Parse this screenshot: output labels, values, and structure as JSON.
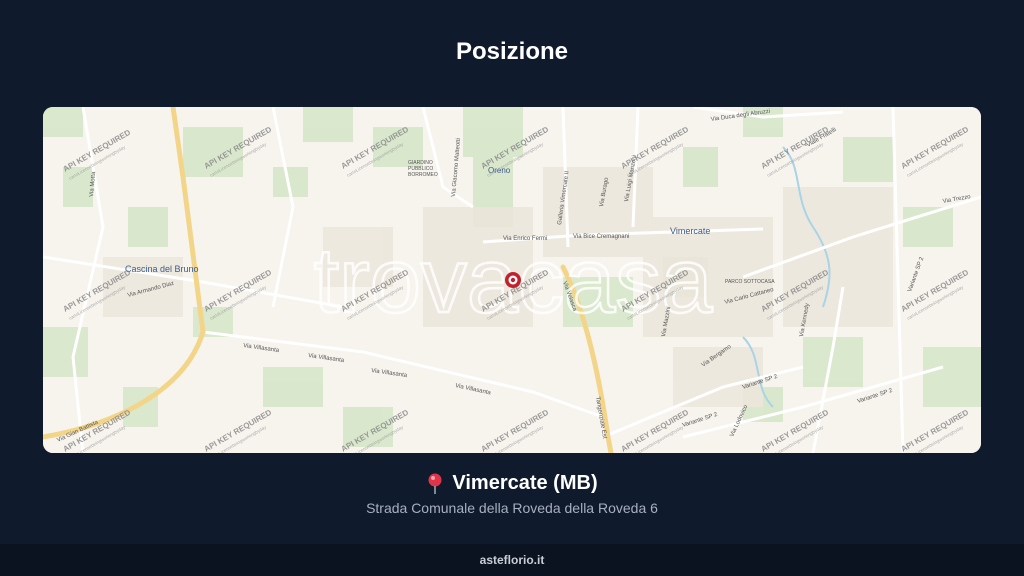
{
  "page": {
    "title": "Posizione"
  },
  "map": {
    "watermark": "trovacasa",
    "api_notice": "API KEY REQUIRED",
    "api_notice_sub": "cartoLicensebeingworkingbyday",
    "place_labels": {
      "vimercate": "Vimercate",
      "oreno": "Oreno",
      "cascina_del_bruno": "Cascina del Bruno",
      "giardino_1": "GIARDINO",
      "giardino_2": "PUBBLICO",
      "giardino_3": "BORROMEO",
      "parco": "PARCO SOTTOCASA"
    },
    "street_labels": {
      "via_villasanta_1": "Via Villasanta",
      "via_villasanta_2": "Via Villasanta",
      "via_villasanta_3": "Via Villasanta",
      "via_villasanta_4": "Via Villasanta",
      "via_enrico_fermi": "Via Enrico Fermi",
      "via_bice_cremagnani": "Via Bice Cremagnani",
      "galleria_vimercate": "Galleria Vimercate II",
      "via_giacomo_matteotti": "Via Giacomo Matteotti",
      "via_duca_abruzzi": "Via Duca degli Abruzzi",
      "via_trezzo": "Via Trezzo",
      "variante_sp2_1": "Variante SP 2",
      "variante_sp2_2": "Variante SP 2",
      "variante_sp2_3": "Variante SP 2",
      "variante_sp2_4": "Variante SP 2",
      "via_carlo_cattaneo": "Via Carlo Cattaneo",
      "via_bergamo": "Via Bergamo",
      "tangenziale_est": "Tangenziale Est",
      "via_gian_battista": "Via Gian Battista",
      "via_luigi_manzoni": "Via Luigi Manzoni",
      "via_burago": "Via Burago",
      "via_kennedy": "Via Kennedy",
      "via_armando_diaz": "Via Armando Diaz",
      "via_mazzini": "Via Mazzini",
      "via_velasca": "Via Velasca",
      "via_motta": "Via Motta",
      "via_lodovico": "Via Lodovico",
      "viale_fratelli": "Viale Fratelli"
    },
    "colors": {
      "land": "#f7f4ee",
      "green": "#cfe3c2",
      "road_major": "#f3d58a",
      "road_minor": "#ffffff",
      "water": "#a9d3e6",
      "marker": "#c0222f",
      "label_blue": "#3a5a8c"
    }
  },
  "location": {
    "pin_icon": "map-pin-icon",
    "title": "Vimercate (MB)",
    "address": "Strada Comunale della Roveda della Roveda 6"
  },
  "footer": {
    "text": "asteflorio.it"
  }
}
